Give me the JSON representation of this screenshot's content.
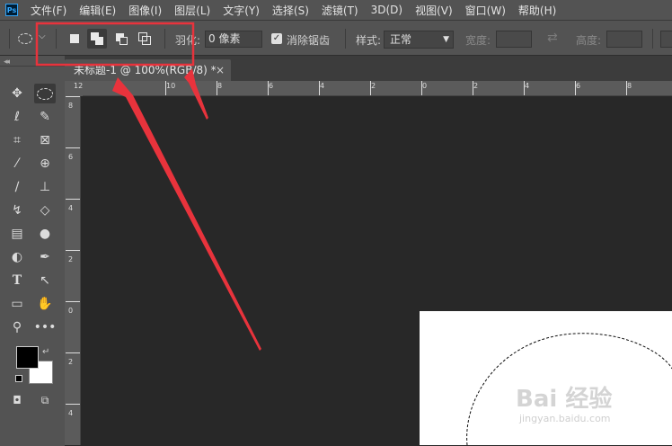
{
  "app": {
    "logo_text": "Ps"
  },
  "menu": [
    "文件(F)",
    "编辑(E)",
    "图像(I)",
    "图层(L)",
    "文字(Y)",
    "选择(S)",
    "滤镜(T)",
    "3D(D)",
    "视图(V)",
    "窗口(W)",
    "帮助(H)"
  ],
  "options": {
    "feather_label": "羽化:",
    "feather_value": "0 像素",
    "antialias_label": "消除锯齿",
    "antialias_checked": true,
    "style_label": "样式:",
    "style_value": "正常",
    "width_label": "宽度:",
    "height_label": "高度:"
  },
  "document_tab": {
    "title": "未标题-1 @ 100%(RGB/8) *",
    "close": "×"
  },
  "ruler": {
    "h_labels": [
      "12",
      "10",
      "8",
      "6",
      "4",
      "2",
      "0",
      "2",
      "4",
      "6",
      "8"
    ],
    "v_labels": [
      "8",
      "6",
      "4",
      "2",
      "0",
      "2",
      "4"
    ]
  },
  "colors": {
    "annotation_red": "#e8333c",
    "foreground": "#000000",
    "background": "#ffffff"
  },
  "watermark": {
    "main": "Bai 经验",
    "sub": "jingyan.baidu.com"
  },
  "tool_icons": [
    "move-icon",
    "elliptical-marquee-icon",
    "lasso-icon",
    "quick-selection-icon",
    "crop-icon",
    "frame-icon",
    "eyedropper-icon",
    "healing-brush-icon",
    "brush-icon",
    "clone-stamp-icon",
    "history-brush-icon",
    "eraser-icon",
    "gradient-icon",
    "blur-icon",
    "dodge-icon",
    "pen-icon",
    "type-icon",
    "path-selection-icon",
    "rectangle-icon",
    "hand-icon",
    "zoom-icon",
    "more-tools-icon"
  ]
}
